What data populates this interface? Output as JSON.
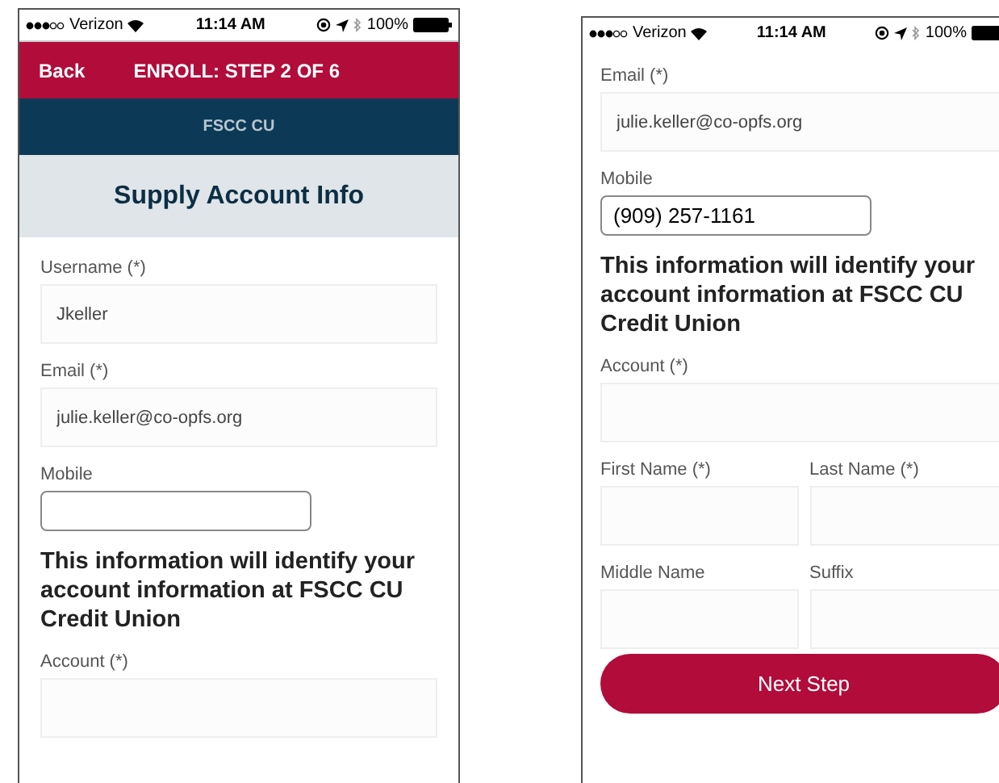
{
  "screens": [
    {
      "status_bar": {
        "carrier": "Verizon",
        "time": "11:14 AM",
        "battery": "100%"
      },
      "header": {
        "back": "Back",
        "title": "ENROLL: STEP 2 OF 6"
      },
      "brand": "FSCC CU",
      "page_title": "Supply Account Info",
      "content": [
        {
          "kind": "field",
          "label": "Username (*)",
          "value": "Jkeller"
        },
        {
          "kind": "field",
          "label": "Email (*)",
          "value": "julie.keller@co-opfs.org"
        },
        {
          "kind": "outlined_field",
          "label": "Mobile"
        },
        {
          "kind": "heading",
          "text": "This information will identify your account information at FSCC CU Credit Union"
        },
        {
          "kind": "field",
          "label": "Account (*)"
        }
      ]
    },
    {
      "status_bar": {
        "carrier": "Verizon",
        "time": "11:14 AM",
        "battery": "100%"
      },
      "content": [
        {
          "kind": "field",
          "label": "Email (*)",
          "value": "julie.keller@co-opfs.org"
        },
        {
          "kind": "outlined_field",
          "label": "Mobile",
          "value": "(909) 257-1161"
        },
        {
          "kind": "heading",
          "text": "This information will identify your account information at FSCC CU Credit Union"
        },
        {
          "kind": "field",
          "label": "Account (*)"
        },
        {
          "kind": "field_pair",
          "fields": [
            {
              "label": "First Name (*)"
            },
            {
              "label": "Last Name (*)"
            }
          ]
        },
        {
          "kind": "field_pair",
          "fields": [
            {
              "label": "Middle Name"
            },
            {
              "label": "Suffix"
            }
          ]
        },
        {
          "kind": "button",
          "label": "Next Step"
        }
      ]
    }
  ]
}
